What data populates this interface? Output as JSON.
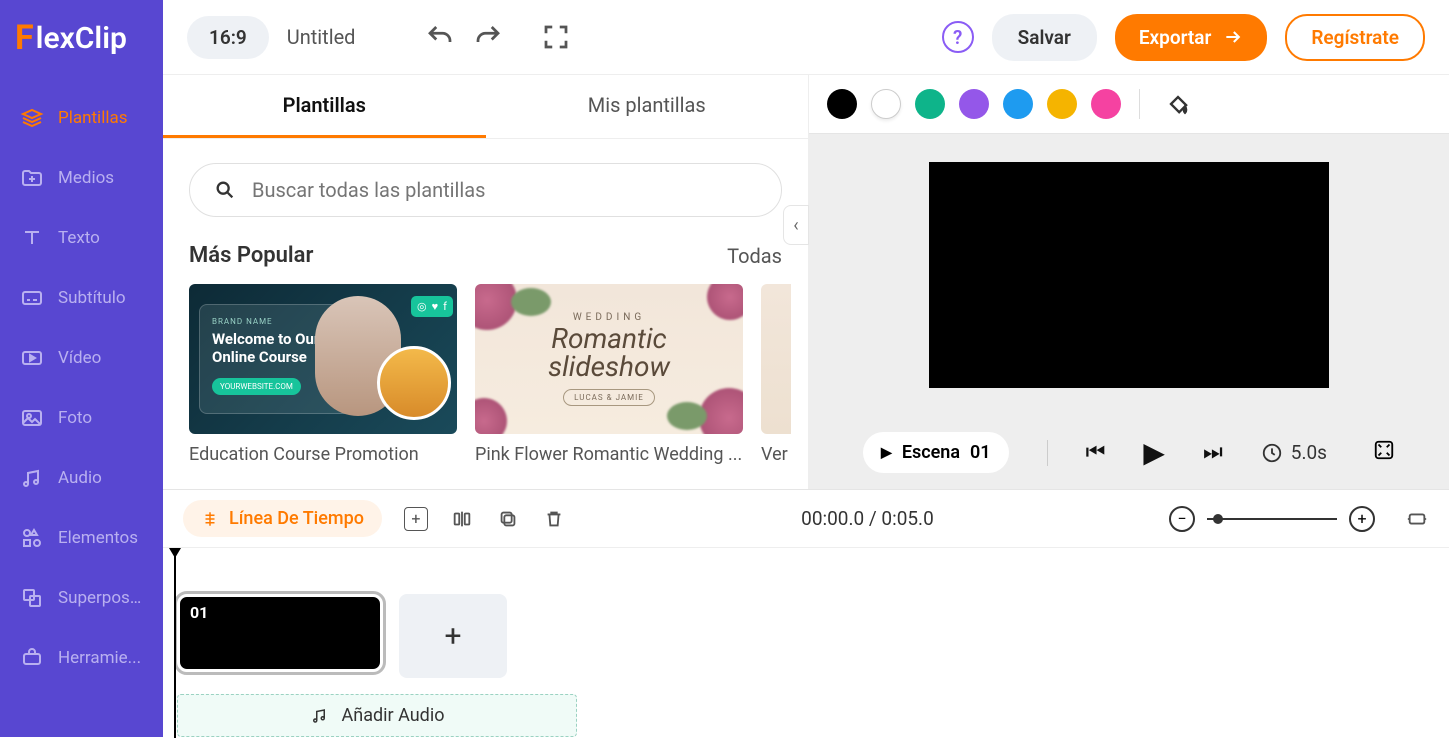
{
  "brand": {
    "first": "F",
    "rest": "lexClip"
  },
  "sidebar": {
    "items": [
      {
        "label": "Plantillas"
      },
      {
        "label": "Medios"
      },
      {
        "label": "Texto"
      },
      {
        "label": "Subtítulo"
      },
      {
        "label": "Vídeo"
      },
      {
        "label": "Foto"
      },
      {
        "label": "Audio"
      },
      {
        "label": "Elementos"
      },
      {
        "label": "Superposi..."
      },
      {
        "label": "Herramie..."
      }
    ]
  },
  "topbar": {
    "ratio": "16:9",
    "title": "Untitled",
    "save": "Salvar",
    "export": "Exportar",
    "register": "Regístrate"
  },
  "panel": {
    "tabs": {
      "templates": "Plantillas",
      "my_templates": "Mis plantillas"
    },
    "search_placeholder": "Buscar todas las plantillas",
    "popular_title": "Más Popular",
    "all_label": "Todas",
    "templates": [
      {
        "brand_line": "BRAND NAME",
        "welcome": "Welcome to Our Online Course",
        "site": "YOURWEBSITE.COM",
        "caption": "Education Course Promotion"
      },
      {
        "small": "WEDDING",
        "script1": "Romantic",
        "script2": "slideshow",
        "names": "LUCAS & JAMIE",
        "caption": "Pink Flower Romantic Wedding ..."
      }
    ],
    "peek_label": "Ver"
  },
  "colors": {
    "swatches": [
      "#000000",
      "#FFFFFF",
      "#0EB48A",
      "#9457E9",
      "#1E9BF0",
      "#F5B400",
      "#F542A1"
    ]
  },
  "player": {
    "scene_label": "Escena",
    "scene_num": "01",
    "duration": "5.0s"
  },
  "timeline": {
    "button": "Línea De Tiempo",
    "time": "00:00.0 / 0:05.0",
    "scene_num": "01",
    "add_audio": "Añadir Audio"
  }
}
